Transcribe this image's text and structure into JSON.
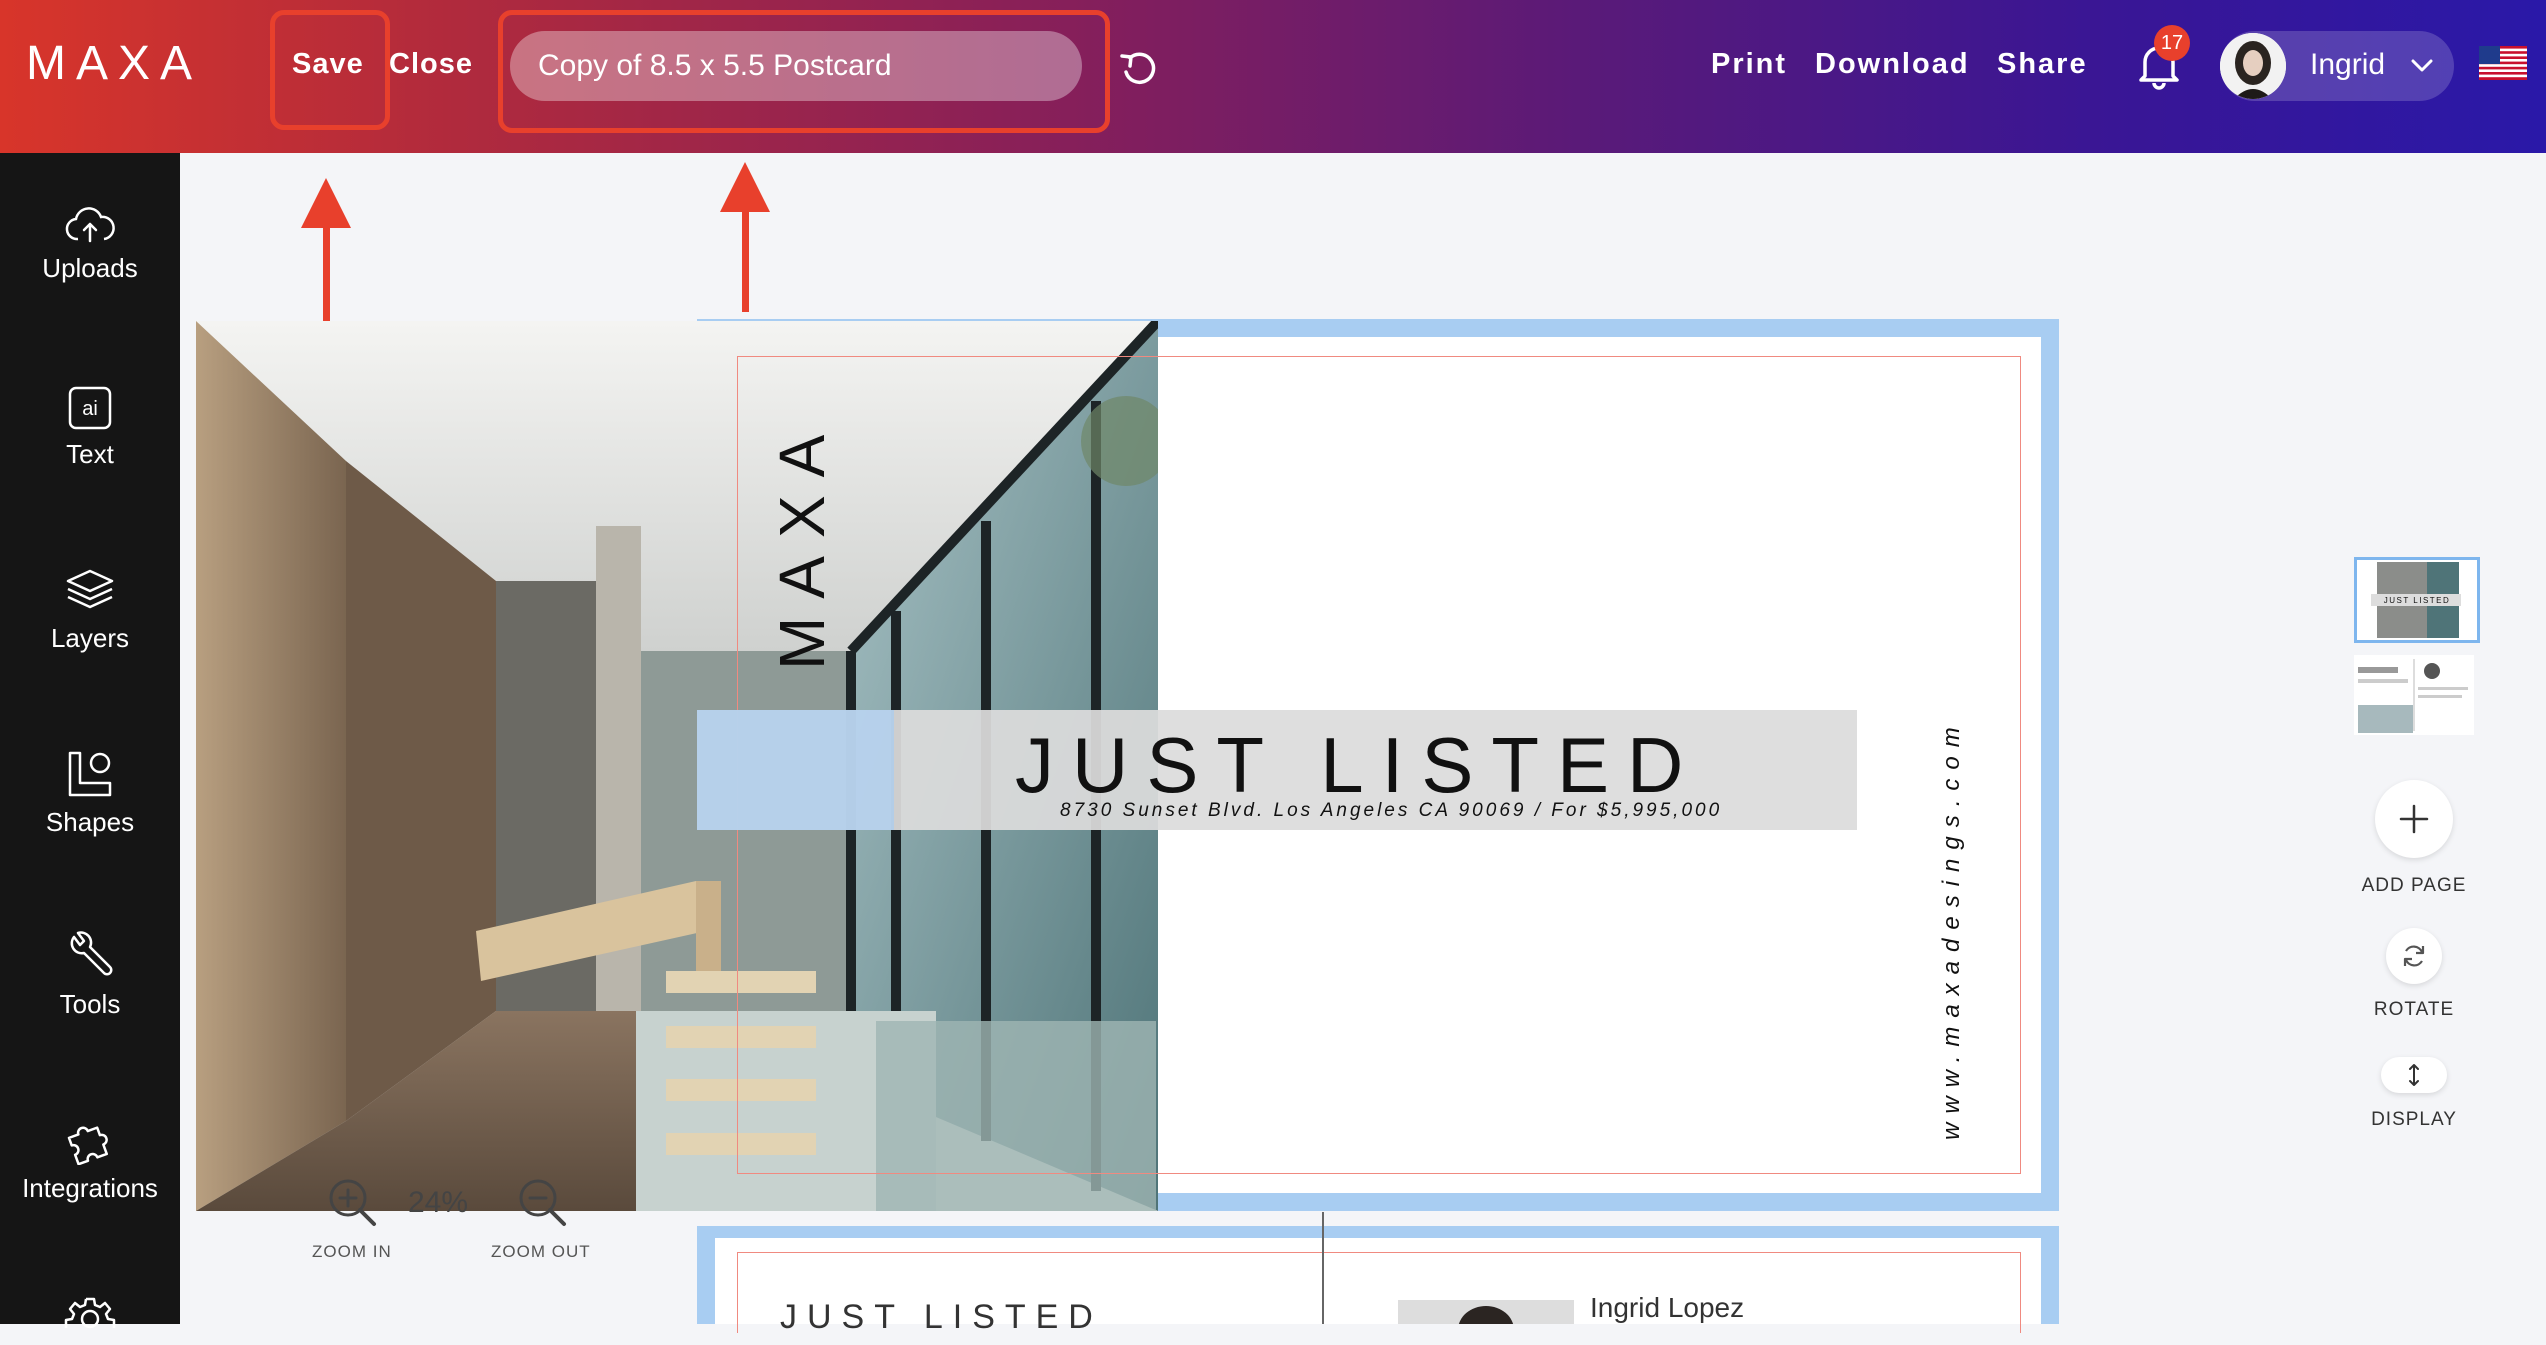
{
  "header": {
    "logo": "MAXA",
    "save_label": "Save",
    "close_label": "Close",
    "document_title": "Copy of 8.5 x 5.5 Postcard",
    "print_label": "Print",
    "download_label": "Download",
    "share_label": "Share",
    "notification_count": "17",
    "user_name": "Ingrid",
    "icons": [
      "undo-icon",
      "bell-icon",
      "chevron-down-icon",
      "us-flag-icon"
    ]
  },
  "sidebar": {
    "items": [
      {
        "label": "Uploads",
        "icon": "cloud-upload-icon"
      },
      {
        "label": "Text",
        "icon": "ai-text-icon"
      },
      {
        "label": "Layers",
        "icon": "layers-icon"
      },
      {
        "label": "Shapes",
        "icon": "shapes-icon"
      },
      {
        "label": "Tools",
        "icon": "wrench-icon"
      },
      {
        "label": "Integrations",
        "icon": "puzzle-icon"
      },
      {
        "label": "",
        "icon": "gear-icon"
      }
    ]
  },
  "design": {
    "brand_vertical": "MAXA",
    "headline": "JUST LISTED",
    "subline": "8730 Sunset Blvd. Los Angeles CA 90069 / For $5,995,000",
    "url_vertical": "www.maxadesings.com",
    "page2_title": "JUST LISTED",
    "page2_name": "Ingrid Lopez"
  },
  "right_panel": {
    "add_page_label": "ADD PAGE",
    "rotate_label": "ROTATE",
    "display_label": "DISPLAY",
    "thumbnail_text": "JUST LISTED"
  },
  "zoom": {
    "zoom_in_label": "ZOOM IN",
    "zoom_out_label": "ZOOM OUT",
    "level": "24%"
  },
  "annotation_color": "#e8402c"
}
